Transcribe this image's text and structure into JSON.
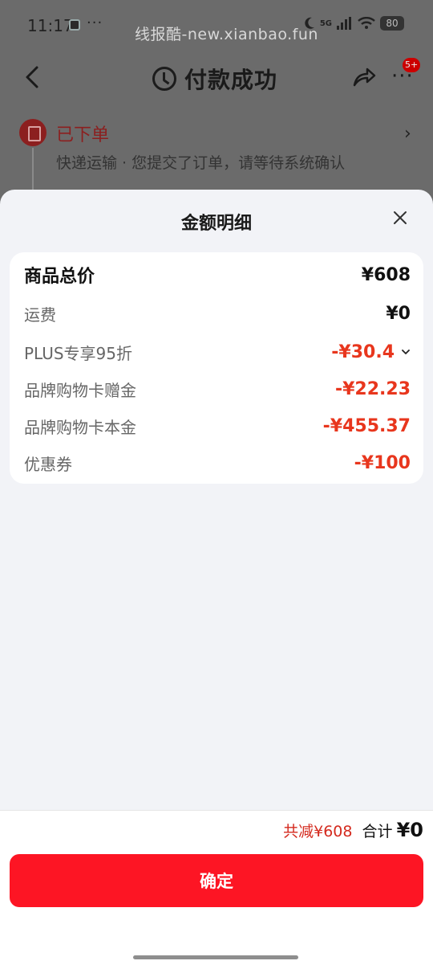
{
  "status_bar": {
    "time": "11:17",
    "dots": "···",
    "network": "5G",
    "battery": "80"
  },
  "watermark": "线报酷-new.xianbao.fun",
  "nav": {
    "title": "付款成功",
    "badge": "5+",
    "more": "···"
  },
  "order": {
    "status": "已下单",
    "description": "快递运输 · 您提交了订单，请等待系统确认",
    "arrow": "›"
  },
  "sheet": {
    "title": "金额明细",
    "rows": [
      {
        "label": "商品总价",
        "value": "¥608"
      },
      {
        "label": "运费",
        "value": "¥0"
      },
      {
        "label": "PLUS专享95折",
        "value": "-¥30.4"
      },
      {
        "label": "品牌购物卡赠金",
        "value": "-¥22.23"
      },
      {
        "label": "品牌购物卡本金",
        "value": "-¥455.37"
      },
      {
        "label": "优惠券",
        "value": "-¥100"
      }
    ]
  },
  "footer": {
    "reduced": "共减¥608",
    "total_label": "合计",
    "total_value": "¥0",
    "confirm_label": "确定"
  },
  "colors": {
    "accent_red": "#fd1524",
    "discount_red": "#e8361d",
    "order_red": "#8c1f1f"
  },
  "icons": [
    "back-icon",
    "clock-icon",
    "share-icon",
    "more-icon",
    "order-icon",
    "close-icon",
    "chevron-down-icon"
  ]
}
